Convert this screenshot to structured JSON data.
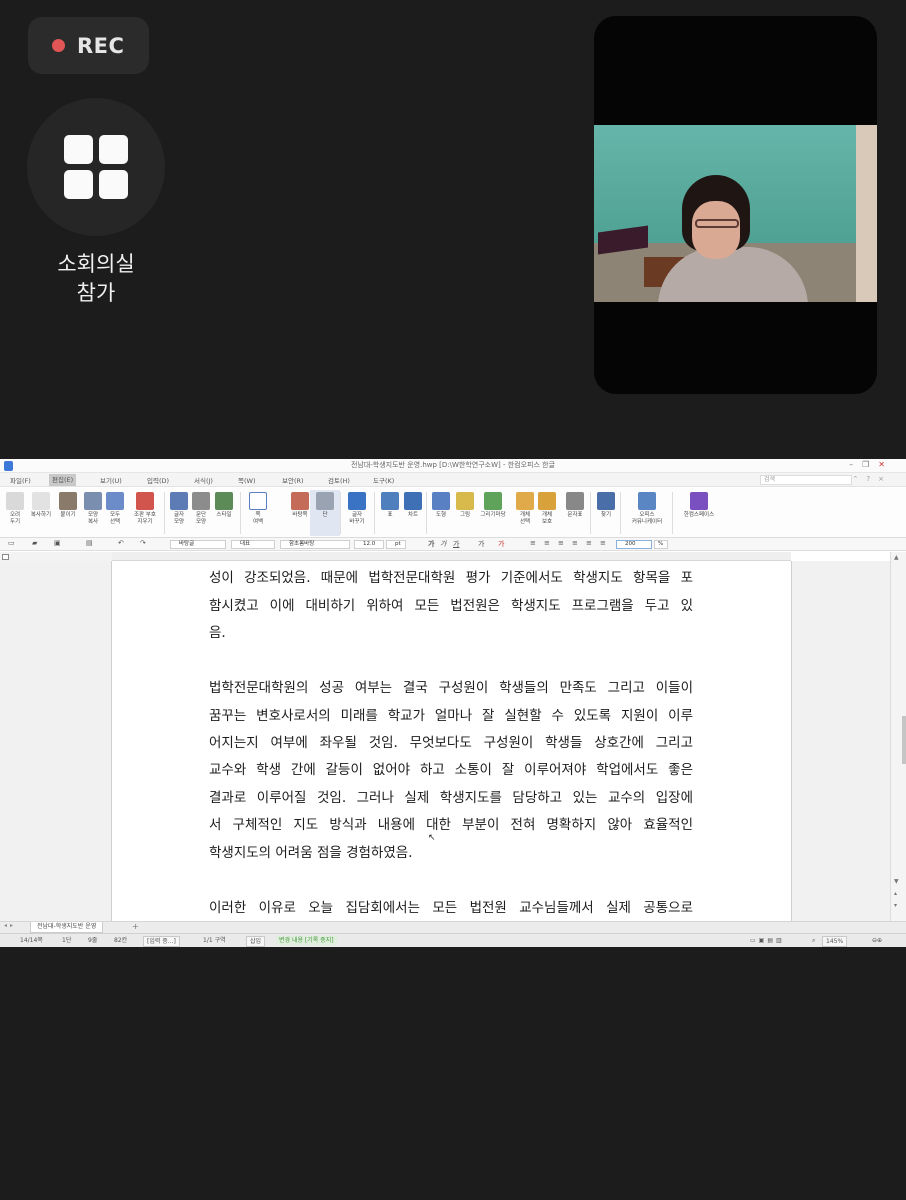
{
  "recording": {
    "label": "REC",
    "dot_color": "#e05555"
  },
  "breakout": {
    "icon": "grid-icon",
    "label_line1": "소회의실",
    "label_line2": "참가"
  },
  "shared_window": {
    "title": "전남대-학생지도반 운영.hwp [D:\\W한학연구소W] - 한컴오피스 한글",
    "menus": [
      "파일(F)",
      "편집(E)",
      "보기(U)",
      "입력(D)",
      "서식(J)",
      "쪽(W)",
      "보안(R)",
      "검토(H)",
      "도구(K)"
    ],
    "active_menu": "편집(E)",
    "help_placeholder": "검색",
    "ribbon_buttons": [
      {
        "label": "오려\n두기",
        "icon": "scissors-icon"
      },
      {
        "label": "복사하기",
        "icon": "copy-icon"
      },
      {
        "label": "붙이기",
        "icon": "paste-icon"
      },
      {
        "label": "모양\n복사",
        "icon": "format-painter-icon"
      },
      {
        "label": "모두\n선택",
        "icon": "select-all-icon"
      },
      {
        "label": "조판 부호\n지우기",
        "icon": "eraser-icon"
      },
      {
        "label": "글자\n모양",
        "icon": "char-shape-icon"
      },
      {
        "label": "문단\n모양",
        "icon": "para-shape-icon"
      },
      {
        "label": "스타일",
        "icon": "style-icon"
      },
      {
        "label": "쪽\n여백",
        "icon": "page-margin-icon"
      },
      {
        "label": "바탕쪽",
        "icon": "master-page-icon"
      },
      {
        "label": "단",
        "icon": "columns-icon"
      },
      {
        "label": "글자\n바꾸기",
        "icon": "replace-char-icon"
      },
      {
        "label": "표",
        "icon": "table-icon"
      },
      {
        "label": "차트",
        "icon": "chart-icon"
      },
      {
        "label": "도형",
        "icon": "shape-icon"
      },
      {
        "label": "그림",
        "icon": "picture-icon"
      },
      {
        "label": "그리기마당",
        "icon": "clipart-icon"
      },
      {
        "label": "개체\n선택",
        "icon": "object-select-icon"
      },
      {
        "label": "개체\n보호",
        "icon": "lock-icon"
      },
      {
        "label": "문자표",
        "icon": "symbol-icon"
      },
      {
        "label": "찾기",
        "icon": "binoculars-icon"
      },
      {
        "label": "오피스\n커뮤니케이터",
        "icon": "people-icon"
      },
      {
        "label": "한컴스페이스",
        "icon": "cloud-icon"
      }
    ],
    "toolbar": {
      "style": "바탕글",
      "lang": "대표",
      "font": "함초롬바탕",
      "size": "12.0",
      "unit": "pt",
      "zoom": "200",
      "zoom_unit": "%"
    },
    "document_lines": [
      "성이 강조되었음. 때문에 법학전문대학원 평가 기준에서도 학생지도 항목을 포",
      "함시켰고 이에 대비하기 위하여 모든 법전원은 학생지도 프로그램을 두고 있",
      "음.",
      "",
      "법학전문대학원의 성공 여부는 결국 구성원이 학생들의 만족도 그리고 이들이",
      "꿈꾸는 변호사로서의 미래를 학교가 얼마나 잘 실현할 수 있도록 지원이 이루",
      "어지는지 여부에 좌우될 것임. 무엇보다도 구성원이 학생들 상호간에 그리고",
      "교수와 학생 간에 갈등이 없어야 하고 소통이 잘 이루어져야 학업에서도 좋은",
      "결과로 이루어질 것임. 그러나 실제 학생지도를 담당하고 있는 교수의 입장에",
      "서 구체적인 지도 방식과 내용에 대한 부분이 전혀 명확하지 않아 효율적인",
      "학생지도의 어려움 점을 경험하였음.",
      "",
      "이러한 이유로 오늘 집담회에서는 모든 법전원 교수님들께서 실제 공통으로"
    ],
    "sheet_tab": "전남대-학생지도반 운영",
    "status": {
      "page": "14/14쪽",
      "section": "1단",
      "line": "9줄",
      "col": "82칸",
      "input_mode": "[입력 중...]",
      "segment": "1/1 구역",
      "insert": "삽입",
      "track": "변경 내용 [기록 중지]",
      "zoom": "145%"
    }
  }
}
